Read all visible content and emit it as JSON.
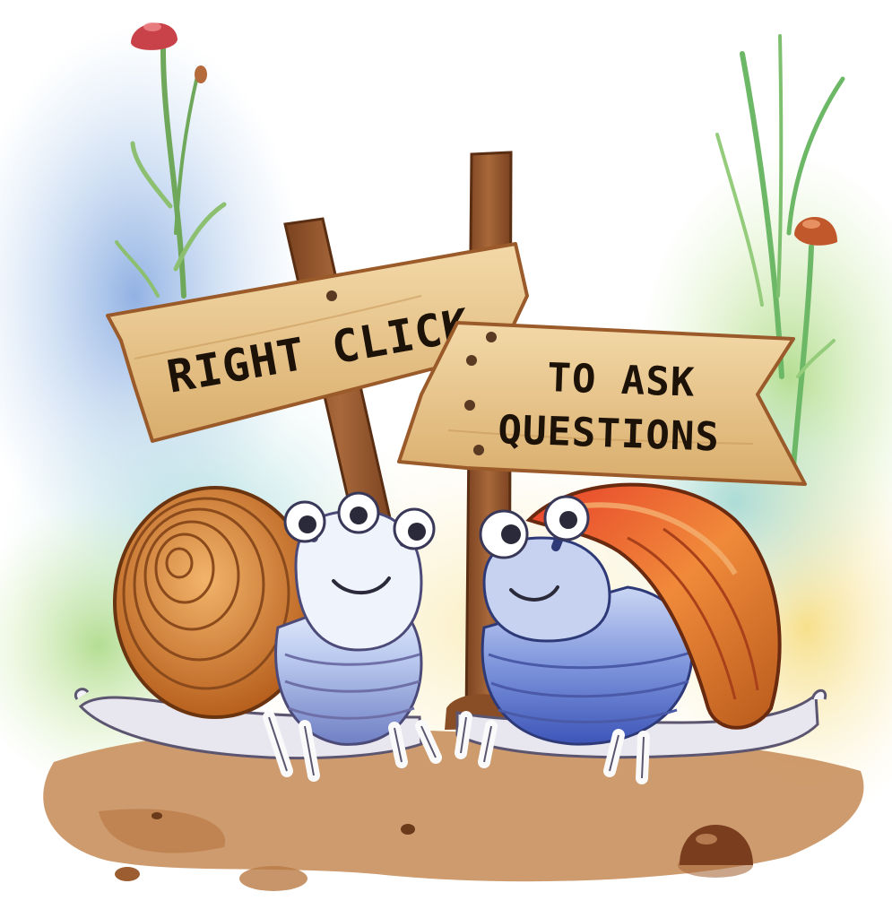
{
  "signs": {
    "left": {
      "line1": "RIGHT CLICK"
    },
    "right": {
      "line1": "TO ASK",
      "line2": "QUESTIONS"
    }
  },
  "colors": {
    "sign_wood": "#e9c890",
    "sign_edge": "#c58a4a",
    "post": "#9a5a2e",
    "ground": "#c98e5a",
    "shell_left": "#d8893e",
    "shell_right": "#d8502c",
    "snail_body": "#8fa6d8",
    "watercolor_blue": "#9bb8e6",
    "watercolor_green": "#b9dc8a"
  },
  "objects": [
    "signpost",
    "left-snail",
    "right-snail",
    "mushroom",
    "grass",
    "pebble"
  ]
}
